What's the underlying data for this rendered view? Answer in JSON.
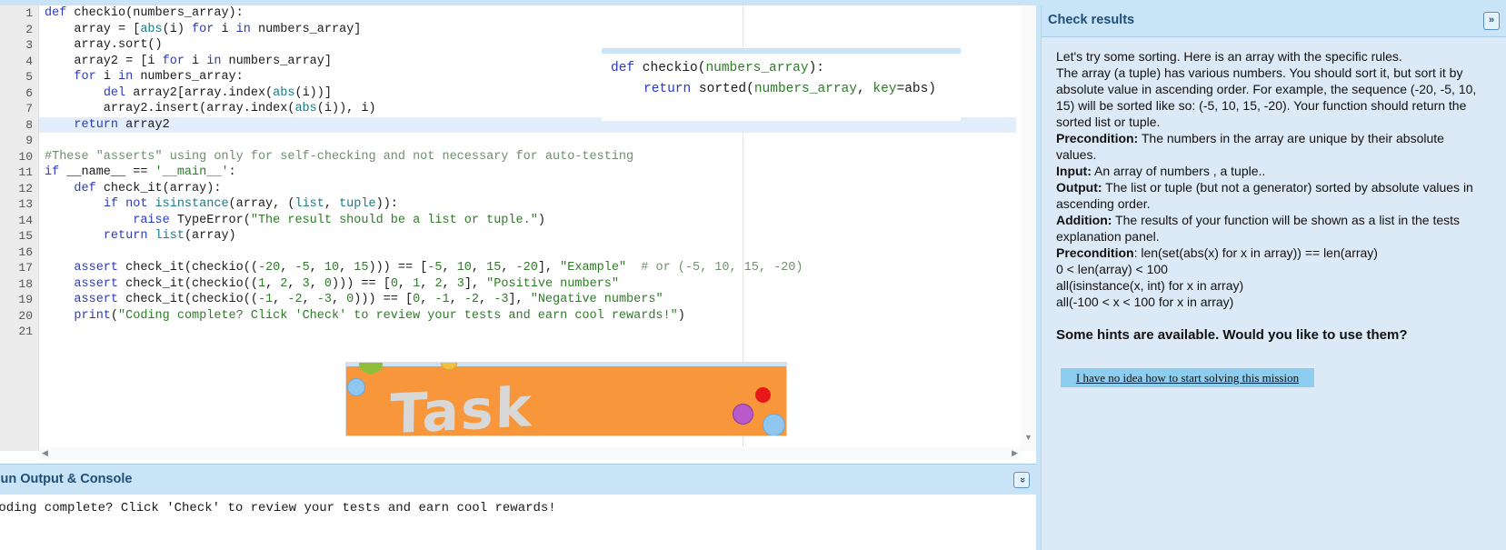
{
  "editor": {
    "line_numbers": [
      "1",
      "2",
      "3",
      "4",
      "5",
      "6",
      "7",
      "8",
      "9",
      "10",
      "11",
      "12",
      "13",
      "14",
      "15",
      "16",
      "17",
      "18",
      "19",
      "20",
      "21"
    ],
    "active_line": 8
  },
  "solution": {
    "line1": {
      "kw": "def",
      "name": " checkio(",
      "arg": "numbers_array",
      "end": "):"
    },
    "line2": {
      "kw": "return",
      "mid": " sorted(",
      "arg": "numbers_array",
      "sep": ", ",
      "key": "key",
      "eq": "=",
      "val": "abs",
      "end": ")"
    }
  },
  "banner": {
    "text": "Task solved!"
  },
  "console": {
    "title": "Run Output & Console",
    "toggle": "»",
    "output": "Coding complete? Click 'Check' to review your tests and earn cool rewards!"
  },
  "panel": {
    "title": "Check results",
    "toggle": "»",
    "intro": "Let's try some sorting. Here is an array with the specific rules.",
    "body": "The array (a tuple) has various numbers. You should sort it, but sort it by absolute value in ascending order. For example, the sequence (-20, -5, 10, 15) will be sorted like so: (-5, 10, 15, -20). Your function should return the sorted list or tuple.",
    "precondition_label": "Precondition:",
    "precondition_text": " The numbers in the array are unique by their absolute values.",
    "input_label": "Input:",
    "input_text": " An array of numbers , a tuple..",
    "output_label": "Output:",
    "output_text": " The list or tuple (but not a generator) sorted by absolute values in ascending order.",
    "addition_label": "Addition:",
    "addition_text": " The results of your function will be shown as a list in the tests explanation panel.",
    "precondition2_label": "Precondition",
    "precondition2_text": ": len(set(abs(x) for x in array)) == len(array)",
    "cond1": "0 < len(array) < 100",
    "cond2": "all(isinstance(x, int) for x in array)",
    "cond3": "all(-100 < x < 100 for x in array)",
    "hints_question": "Some hints are available. Would you like to use them?",
    "hint_button": "I have no idea how to start solving this mission"
  },
  "colors": {
    "accent": "#c9e4f7",
    "panel_bg": "#dce9f7",
    "title": "#1f4f78",
    "keyword": "#2c3bbd",
    "string": "#2e7b27",
    "banner": "#f7963a"
  }
}
